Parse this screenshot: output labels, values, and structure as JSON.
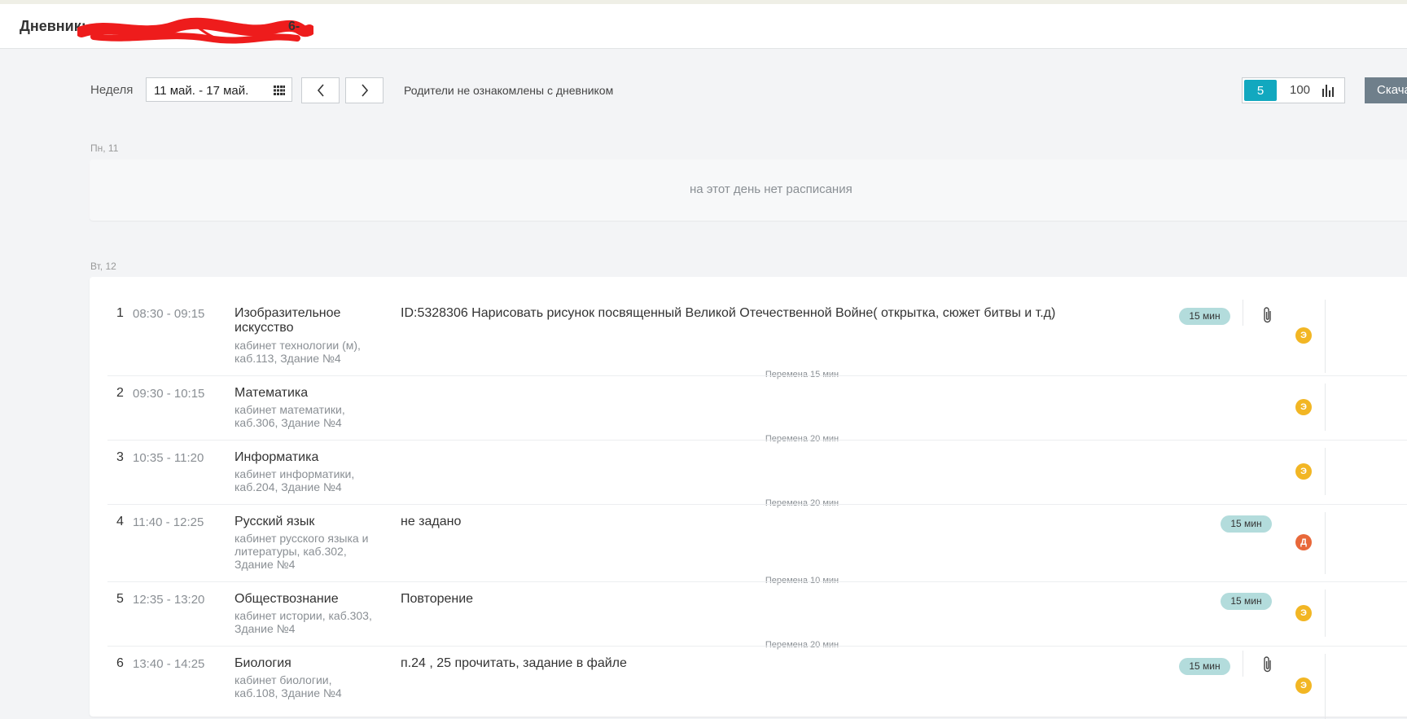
{
  "header": {
    "title_prefix": "Дневник:",
    "title_suffix": "6-"
  },
  "toolbar": {
    "week_label": "Неделя",
    "week_range": "11 май. - 17 май.",
    "parents_note": "Родители не ознакомлены с дневником",
    "scale_5": "5",
    "scale_100": "100",
    "download_label": "Скача"
  },
  "days": [
    {
      "label": "Пн, 11",
      "empty_text": "на этот день нет расписания"
    },
    {
      "label": "Вт, 12",
      "lessons": [
        {
          "num": "1",
          "time": "08:30 - 09:15",
          "subject": "Изобразительное искусство",
          "room": "кабинет технологии (м), каб.113, Здание №4",
          "homework": "ID:5328306 Нарисовать рисунок посвященный Великой Отечественной Войне( открытка, сюжет битвы и т.д)",
          "duration": "15 мин",
          "attachment": true,
          "grade_letter": "Э",
          "grade_color": "#f2b624"
        },
        {
          "num": "2",
          "time": "09:30 - 10:15",
          "subject": "Математика",
          "room": "кабинет математики, каб.306, Здание №4",
          "homework": "",
          "duration": "",
          "attachment": false,
          "grade_letter": "Э",
          "grade_color": "#f2b624"
        },
        {
          "num": "3",
          "time": "10:35 - 11:20",
          "subject": "Информатика",
          "room": "кабинет информатики, каб.204, Здание №4",
          "homework": "",
          "duration": "",
          "attachment": false,
          "grade_letter": "Э",
          "grade_color": "#f2b624"
        },
        {
          "num": "4",
          "time": "11:40 - 12:25",
          "subject": "Русский язык",
          "room": "кабинет русского языка и литературы, каб.302, Здание №4",
          "homework": "не задано",
          "duration": "15 мин",
          "attachment": false,
          "grade_letter": "Д",
          "grade_color": "#e8683a"
        },
        {
          "num": "5",
          "time": "12:35 - 13:20",
          "subject": "Обществознание",
          "room": "кабинет истории, каб.303, Здание №4",
          "homework": "Повторение",
          "duration": "15 мин",
          "attachment": false,
          "grade_letter": "Э",
          "grade_color": "#f2b624"
        },
        {
          "num": "6",
          "time": "13:40 - 14:25",
          "subject": "Биология",
          "room": "кабинет биологии, каб.108, Здание №4",
          "homework": "п.24 , 25 прочитать, задание в файле",
          "duration": "15 мин",
          "attachment": true,
          "grade_letter": "Э",
          "grade_color": "#f2b624"
        }
      ],
      "breaks": [
        "Перемена 15 мин",
        "Перемена 20 мин",
        "Перемена 20 мин",
        "Перемена 10 мин",
        "Перемена 20 мин"
      ]
    }
  ],
  "colors": {
    "accent": "#12a8bf",
    "badge_bg": "#b3dcdc",
    "download_bg": "#6f7f8b",
    "redaction": "#ee1c1c"
  }
}
